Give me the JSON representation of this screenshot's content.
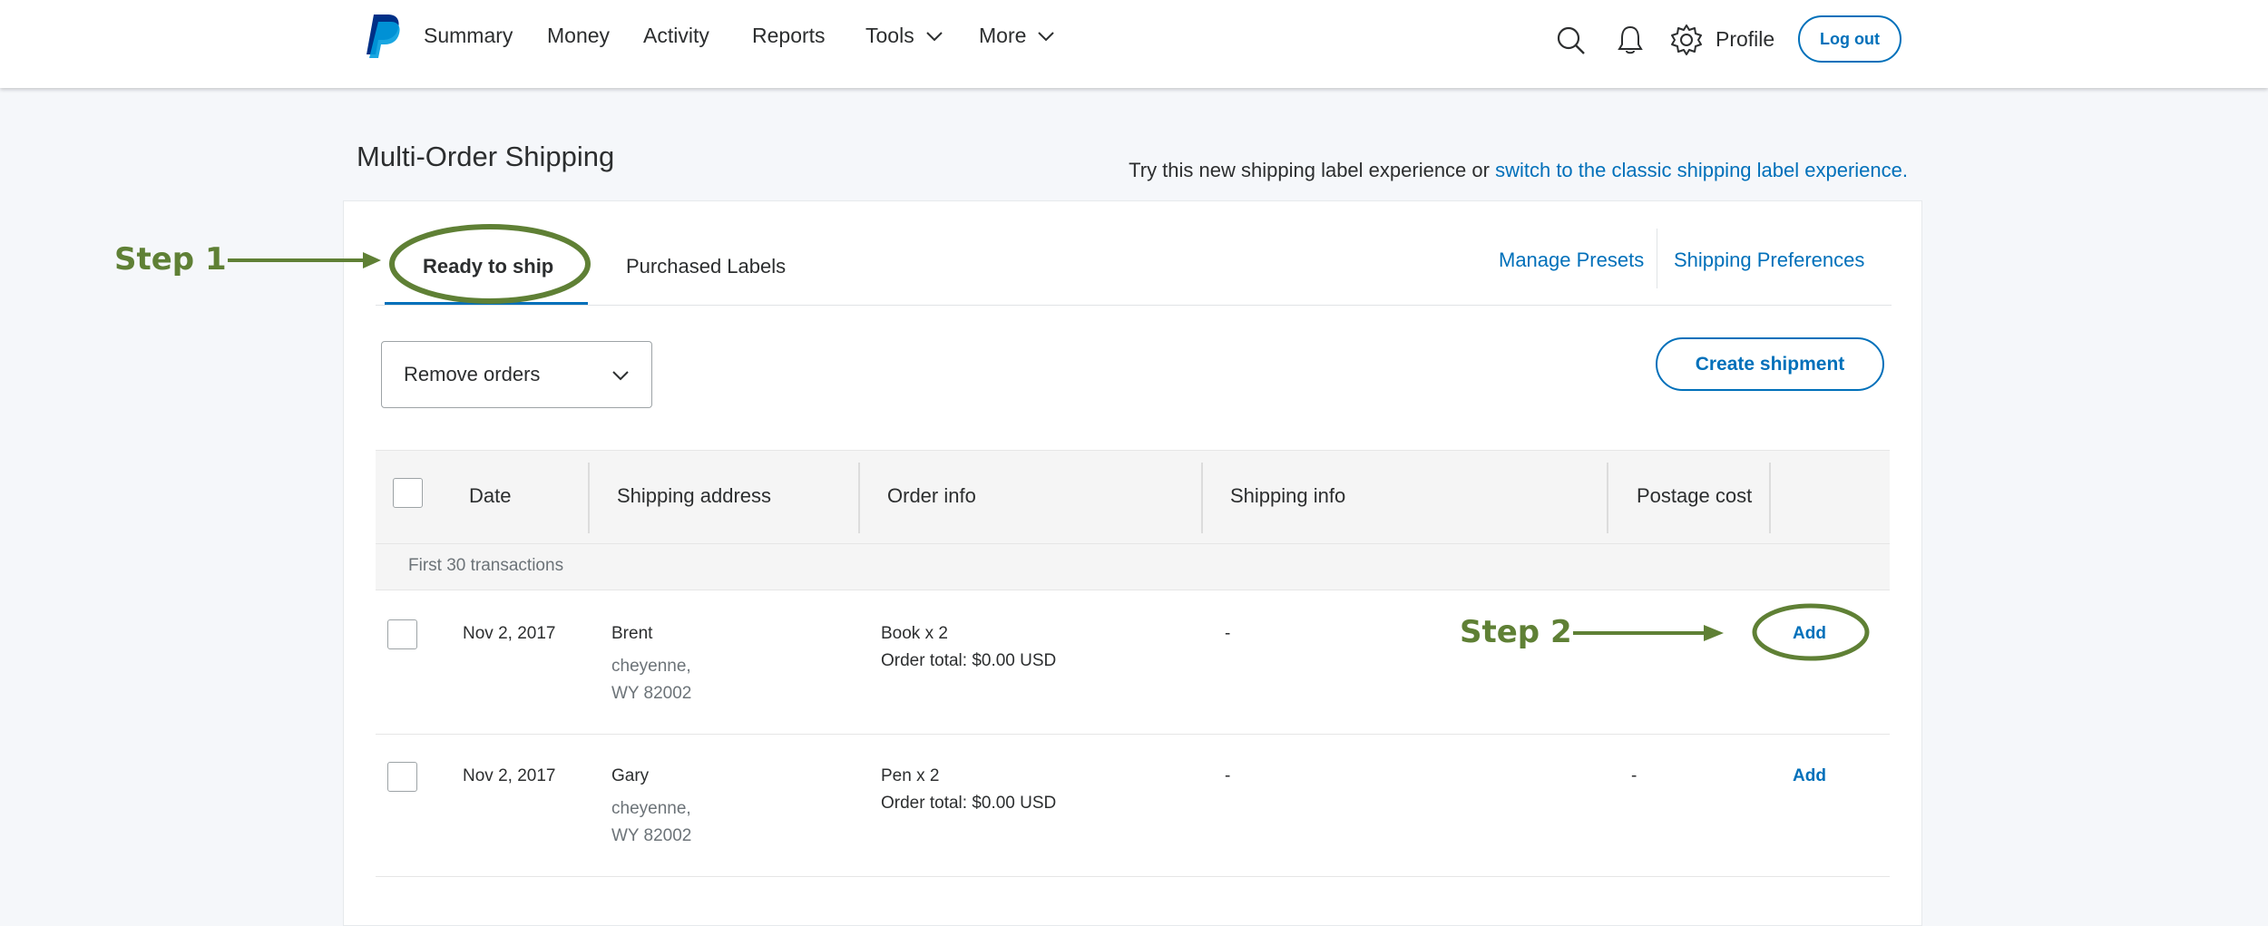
{
  "nav": {
    "items": [
      {
        "label": "Summary"
      },
      {
        "label": "Money"
      },
      {
        "label": "Activity"
      },
      {
        "label": "Reports"
      },
      {
        "label": "Tools"
      },
      {
        "label": "More"
      }
    ],
    "profile_label": "Profile",
    "logout_label": "Log out"
  },
  "page": {
    "title": "Multi-Order Shipping",
    "try_text": "Try this new shipping label experience or ",
    "try_link": "switch to the classic shipping label experience."
  },
  "tabs": {
    "ready": "Ready to ship",
    "purchased": "Purchased Labels"
  },
  "links": {
    "manage_presets": "Manage Presets",
    "shipping_preferences": "Shipping Preferences"
  },
  "actions": {
    "select_value": "Remove orders",
    "create_shipment": "Create shipment"
  },
  "table": {
    "headers": [
      "Date",
      "Shipping address",
      "Order info",
      "Shipping info",
      "Postage cost"
    ],
    "group_label": "First 30 transactions",
    "rows": [
      {
        "date": "Nov 2, 2017",
        "name": "Brent",
        "city": "cheyenne,",
        "state": "WY 82002",
        "item": "Book x 2",
        "total": "Order total: $0.00 USD",
        "shipping": "-",
        "postage": "",
        "action": "Add"
      },
      {
        "date": "Nov 2, 2017",
        "name": "Gary",
        "city": "cheyenne,",
        "state": "WY 82002",
        "item": "Pen x 2",
        "total": "Order total: $0.00 USD",
        "shipping": "-",
        "postage": "-",
        "action": "Add"
      }
    ]
  },
  "annotations": {
    "step1": "Step 1",
    "step2": "Step 2",
    "color": "#5f8035"
  },
  "colors": {
    "accent": "#0070ba",
    "logo_dark": "#003087",
    "logo_light": "#009cde",
    "background": "#f5f7fa"
  },
  "icons": [
    "paypal-logo",
    "search-icon",
    "bell-icon",
    "gear-icon",
    "chevron-down-icon",
    "arrow-right-icon"
  ]
}
